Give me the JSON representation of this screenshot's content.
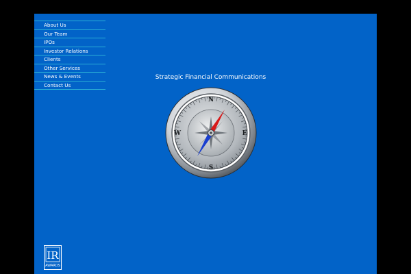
{
  "nav": {
    "items": [
      {
        "label": "About Us"
      },
      {
        "label": "Our Team"
      },
      {
        "label": "IPOs"
      },
      {
        "label": "Investor Relations"
      },
      {
        "label": "Clients"
      },
      {
        "label": "Other Services"
      },
      {
        "label": "News & Events"
      },
      {
        "label": "Contact Us"
      }
    ]
  },
  "tagline": "Strategic Financial Communications",
  "compass": {
    "icon": "compass-icon",
    "directions": {
      "n": "N",
      "e": "E",
      "s": "S",
      "w": "W"
    }
  },
  "awards_logo": {
    "icon": "ir-awards-logo",
    "text": "IR",
    "subtext": "AWARDS"
  },
  "colors": {
    "background": "#000000",
    "page": "#0263c8",
    "nav_divider": "#2bb0d6",
    "text": "#ffffff",
    "needle_north": "#d81a1a",
    "needle_south": "#1a3fd0"
  }
}
